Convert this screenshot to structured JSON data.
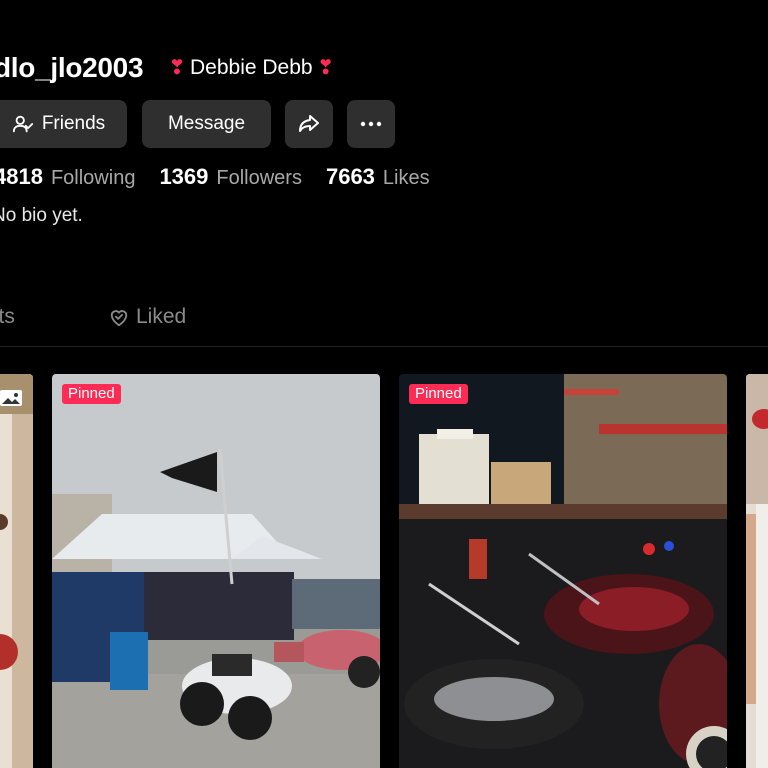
{
  "profile": {
    "username": "dlo_jlo2003",
    "nickname": "Debbie Debb",
    "heart_glyph": "❣",
    "bio": "No bio yet."
  },
  "buttons": {
    "friends_label": "Friends",
    "message_label": "Message"
  },
  "stats": {
    "following_count": "4818",
    "following_label": "Following",
    "followers_count": "1369",
    "followers_label": "Followers",
    "likes_count": "7663",
    "likes_label": "Likes"
  },
  "tabs": {
    "posts_label": "sts",
    "liked_label": "Liked"
  },
  "grid": {
    "pinned_label": "Pinned"
  },
  "colors": {
    "accent": "#fe2c55",
    "button_bg": "#2f2f2f",
    "background": "#000000"
  }
}
